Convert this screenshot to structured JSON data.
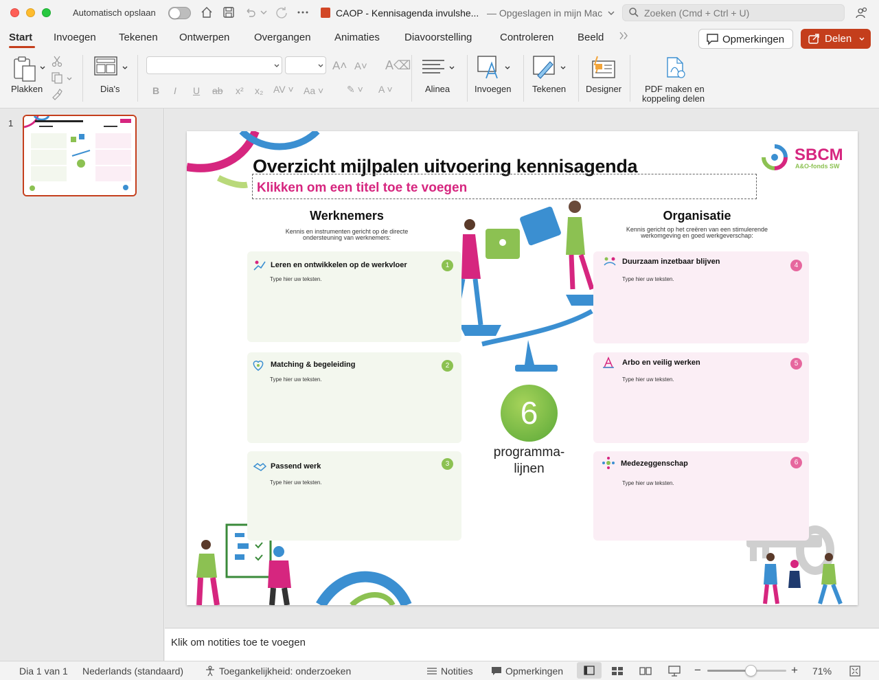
{
  "titlebar": {
    "autosave_label": "Automatisch opslaan",
    "doc_title": "CAOP - Kennisagenda invulshe...",
    "doc_saved": "— Opgeslagen in mijn Mac",
    "search_placeholder": "Zoeken (Cmd + Ctrl + U)"
  },
  "tabs": [
    "Start",
    "Invoegen",
    "Tekenen",
    "Ontwerpen",
    "Overgangen",
    "Animaties",
    "Diavoorstelling",
    "Controleren",
    "Beeld"
  ],
  "actions": {
    "comments": "Opmerkingen",
    "share": "Delen"
  },
  "ribbon": {
    "paste": "Plakken",
    "slides": "Dia's",
    "paragraph": "Alinea",
    "insert": "Invoegen",
    "draw": "Tekenen",
    "designer": "Designer",
    "pdf_line1": "PDF maken en",
    "pdf_line2": "koppeling delen"
  },
  "thumbnail": {
    "number": "1"
  },
  "slide": {
    "title": "Overzicht mijlpalen uitvoering kennisagenda",
    "subtitle": "Klikken om een titel toe te voegen",
    "logo": {
      "name": "SBCM",
      "tagline": "A&O-fonds SW"
    },
    "left_column": {
      "heading": "Werknemers",
      "desc_line1": "Kennis en instrumenten gericht op de directe",
      "desc_line2": "ondersteuning van werknemers:"
    },
    "right_column": {
      "heading": "Organisatie",
      "desc_line1": "Kennis gericht op het creëren van een stimulerende",
      "desc_line2": "werkomgeving en goed werkgeverschap:"
    },
    "cards": [
      {
        "title": "Leren en ontwikkelen op de werkvloer",
        "text": "Type hier uw teksten.",
        "number": "1"
      },
      {
        "title": "Matching & begeleiding",
        "text": "Type hier uw teksten.",
        "number": "2"
      },
      {
        "title": "Passend werk",
        "text": "Type hier uw teksten.",
        "number": "3"
      },
      {
        "title": "Duurzaam inzetbaar blijven",
        "text": "Type hier uw teksten.",
        "number": "4"
      },
      {
        "title": "Arbo en veilig werken",
        "text": "Type hier uw teksten.",
        "number": "5"
      },
      {
        "title": "Medezeggenschap",
        "text": "Type hier uw teksten.",
        "number": "6"
      }
    ],
    "center": {
      "number": "6",
      "label_line1": "programma-",
      "label_line2": "lijnen"
    }
  },
  "notes": {
    "placeholder": "Klik om notities toe te voegen"
  },
  "status": {
    "slide_counter": "Dia 1 van 1",
    "language": "Nederlands (standaard)",
    "accessibility": "Toegankelijkheid: onderzoeken",
    "notes_btn": "Notities",
    "comments_btn": "Opmerkingen",
    "zoom_level": 0.55,
    "zoom": "71%"
  },
  "colors": {
    "accent": "#c43e1c",
    "pink": "#d6267f",
    "green": "#8cc152",
    "blue": "#3b8fd1"
  }
}
